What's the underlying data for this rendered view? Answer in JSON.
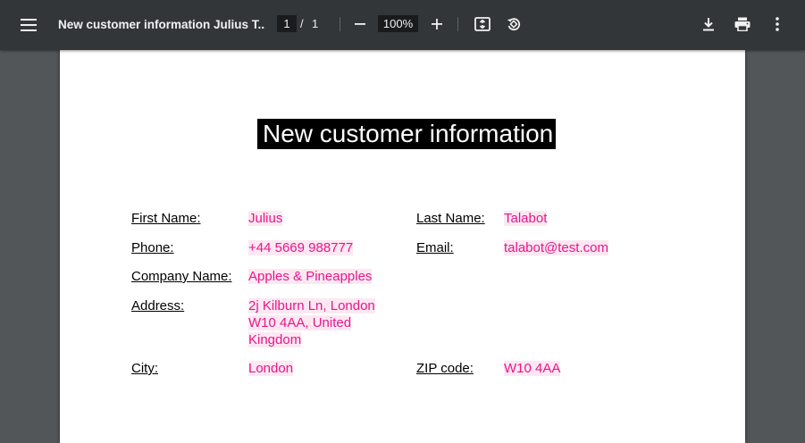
{
  "toolbar": {
    "title": "New customer information Julius T...",
    "current_page": "1",
    "page_separator": "/",
    "total_pages": "1",
    "zoom": "100%",
    "icons": {
      "menu": "hamburger-menu-icon",
      "zoom_out": "minus-icon",
      "zoom_in": "plus-icon",
      "fit": "fit-to-page-icon",
      "rotate": "rotate-counterclockwise-icon",
      "download": "download-icon",
      "print": "print-icon",
      "more": "more-vert-icon"
    }
  },
  "document": {
    "heading": "New customer information",
    "fields": {
      "first_name": {
        "label": "First Name:",
        "value": "Julius"
      },
      "last_name": {
        "label": "Last Name:",
        "value": "Talabot"
      },
      "phone": {
        "label": "Phone:",
        "value": "+44 5669 988777"
      },
      "email": {
        "label": "Email:",
        "value": "talabot@test.com"
      },
      "company": {
        "label": "Company Name:",
        "value": "Apples & Pineapples"
      },
      "address": {
        "label": "Address:",
        "value": "2j Kilburn Ln, London W10 4AA, United Kingdom"
      },
      "city": {
        "label": "City:",
        "value": "London"
      },
      "zip": {
        "label": "ZIP code:",
        "value": "W10 4AA"
      }
    }
  },
  "colors": {
    "toolbar_bg": "#323639",
    "viewer_bg": "#525659",
    "field_text": "#e8168b",
    "field_highlight": "#fce8f2",
    "heading_bg": "#000000"
  }
}
